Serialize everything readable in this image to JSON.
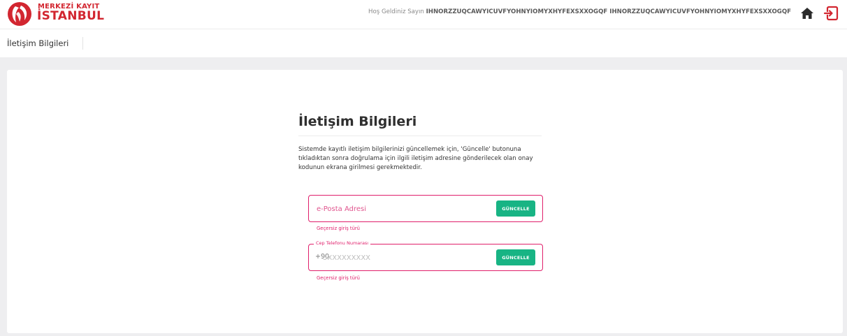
{
  "header": {
    "logo_line1": "MERKEZİ KAYIT",
    "logo_line2": "İSTANBUL",
    "welcome_prefix": "Hoş Geldiniz Sayın",
    "user_name": "IHNORZZUQCAWYICUVFYOHNYIOMYXHYFEXSXXOGQF IHNORZZUQCAWYICUVFYOHNYIOMYXHYFEXSXXOGQF",
    "icons": [
      "home-icon",
      "logout-icon"
    ],
    "accent_color": "#d22630"
  },
  "breadcrumb": {
    "title": "İletişim Bilgileri"
  },
  "form": {
    "title": "İletişim Bilgileri",
    "description": "Sistemde kayıtlı iletişim bilgilerinizi güncellemek için, 'Güncelle' butonuna tıkladıktan sonra doğrulama için ilgili iletişim adresine gönderilecek olan onay kodunun ekrana girilmesi gerekmektedir.",
    "email": {
      "placeholder": "e-Posta Adresi",
      "value": "",
      "button_label": "GÜNCELLE",
      "error": "Geçersiz giriş türü"
    },
    "phone": {
      "label": "Cep Telefonu Numarası",
      "prefix": "+90",
      "placeholder": "5XXXXXXXXX",
      "value": "",
      "button_label": "GÜNCELLE",
      "error": "Geçersiz giriş türü"
    },
    "colors": {
      "error": "#e01f6b",
      "button": "#18b484"
    }
  }
}
